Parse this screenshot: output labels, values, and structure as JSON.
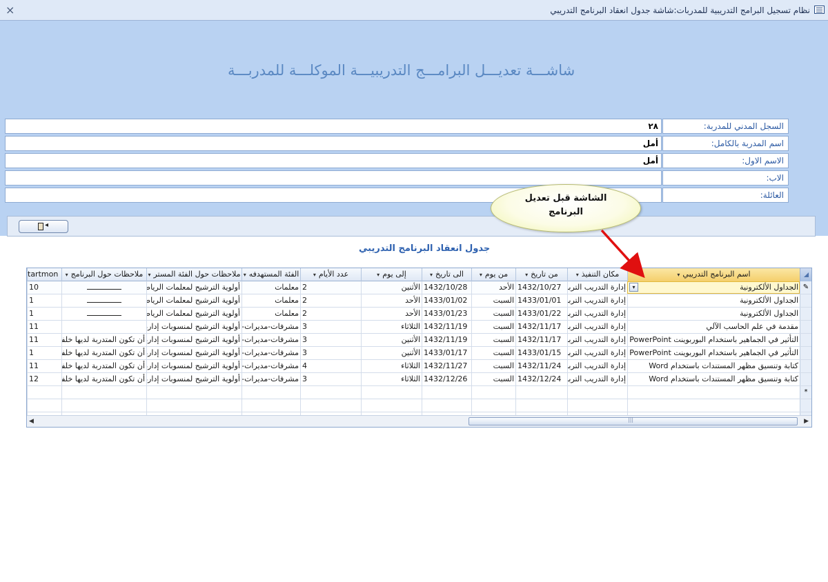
{
  "window": {
    "title": "نظام تسجيل البرامج التدريبية للمدربات:شاشة جدول انعقاد البرنامج التدريبي",
    "close_label": "×"
  },
  "form": {
    "title": "شاشـــة تعديـــل البرامـــج التدريبيـــة الموكلـــة للمدربـــة"
  },
  "fields": [
    {
      "label": "السجل المدني للمدربة:",
      "value": "٢٨"
    },
    {
      "label": "اسم المدربة بالكامل:",
      "value": "أمل"
    },
    {
      "label": "الاسم الاول:",
      "value": "أمل"
    },
    {
      "label": "الاب:",
      "value": ""
    },
    {
      "label": "العائلة:",
      "value": ""
    }
  ],
  "callout": {
    "line1": "الشاشة قبل تعديل",
    "line2": "البرنامج"
  },
  "subform": {
    "title": "جدول انعقاد البرنامج التدريبي",
    "columns": [
      "اسم البرنامج التدريبي",
      "مكان التنفيذ",
      "من تاريخ",
      "من يوم",
      "الى تاريخ",
      "إلى يوم",
      "عدد الأيام",
      "الفئة المستهدفه",
      "ملاحظات حول الفئة المستر",
      "ملاحظات حول البرنامج",
      "tartmon"
    ],
    "rows": [
      [
        "الجداول الألكترونية",
        "إدارة التدريب التربوي",
        "1432/10/27",
        "الأحد",
        "1432/10/28",
        "الأثنين",
        "2",
        "معلمات",
        "أولوية الترشيح لمعلمات الرياضيات",
        "",
        "10"
      ],
      [
        "الجداول الألكترونية",
        "إدارة التدريب التربوي",
        "1433/01/01",
        "السبت",
        "1433/01/02",
        "الأحد",
        "2",
        "معلمات",
        "أولوية الترشيح لمعلمات الرياضيات",
        "",
        "1"
      ],
      [
        "الجداول الألكترونية",
        "إدارة التدريب التربوي",
        "1433/01/22",
        "السبت",
        "1433/01/23",
        "الأحد",
        "2",
        "معلمات",
        "أولوية الترشيح لمعلمات الرياضيات",
        "",
        "1"
      ],
      [
        "مقدمة في علم الحاسب الآلي",
        "إدارة التدريب التربوي",
        "1432/11/17",
        "السبت",
        "1432/11/19",
        "الثلاثاء",
        "3",
        "مشرفات-مديرات-",
        "أولوية الترشيح لمنسوبات إدارة",
        "",
        "11"
      ],
      [
        "التأثير في الجماهير باستخدام البوربوينت PowerPoint",
        "إدارة التدريب التربوي",
        "1432/11/17",
        "السبت",
        "1432/11/19",
        "الأثنين",
        "3",
        "مشرفات-مديرات-",
        "أولوية الترشيح لمنسوبات إدارة",
        "أن تكون المتدربة لديها خلفية",
        "11"
      ],
      [
        "التأثير في الجماهير باستخدام البوربوينت PowerPoint",
        "إدارة التدريب التربوي",
        "1433/01/15",
        "السبت",
        "1433/01/17",
        "الأثنين",
        "3",
        "مشرفات-مديرات-",
        "أولوية الترشيح لمنسوبات إدارة",
        "أن تكون المتدربة لديها خلفية",
        "1"
      ],
      [
        "كتابة وتنسيق مظهر المستندات باستخدام Word",
        "إدارة التدريب التربوي",
        "1432/11/24",
        "السبت",
        "1432/11/27",
        "الثلاثاء",
        "4",
        "مشرفات-مديرات-",
        "أولوية الترشيح لمنسوبات إدارة",
        "أن تكون المتدربة لديها خلفية",
        "11"
      ],
      [
        "كتابة وتنسيق مظهر المستندات باستخدام Word",
        "إدارة التدريب التربوي",
        "1432/12/24",
        "السبت",
        "1432/12/26",
        "الثلاثاء",
        "3",
        "مشرفات-مديرات-",
        "أولوية الترشيح لمنسوبات إدارة",
        "أن تكون المتدربة لديها خلفية",
        "12"
      ]
    ],
    "new_row_marker": "*",
    "edit_marker": "✎"
  },
  "icons": {
    "close": "close-icon",
    "form": "form-icon",
    "exit": "exit-door-icon",
    "dropdown": "dropdown-arrow-icon",
    "pencil": "pencil-icon"
  },
  "colors": {
    "header_bg": "#b9d2f2",
    "title_blue": "#5a88c2",
    "label_blue": "#2c5aa3",
    "callout_arrow": "#e01010"
  }
}
